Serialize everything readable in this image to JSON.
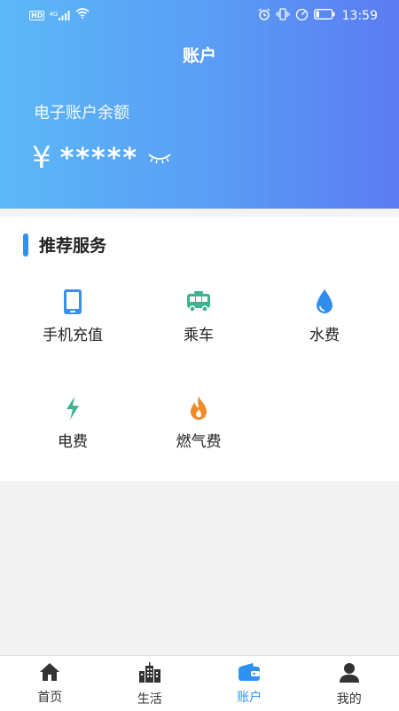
{
  "status_bar": {
    "hd_badge": "HD",
    "signal_type": "4G",
    "battery_level": 0.2,
    "time": "13:59"
  },
  "header": {
    "title": "账户",
    "balance_label": "电子账户余额",
    "currency_symbol": "¥",
    "balance_masked": "*****"
  },
  "services": {
    "section_title": "推荐服务",
    "items": [
      {
        "label": "手机充值",
        "icon": "phone-icon",
        "color": "#3a8ef0"
      },
      {
        "label": "乘车",
        "icon": "bus-icon",
        "color": "#3fb28f"
      },
      {
        "label": "水费",
        "icon": "water-drop-icon",
        "color": "#2f8ef0"
      },
      {
        "label": "电费",
        "icon": "lightning-icon",
        "color": "#3fb28f"
      },
      {
        "label": "燃气费",
        "icon": "flame-icon",
        "color": "#f08a2c"
      }
    ]
  },
  "tabbar": {
    "active_index": 2,
    "accent": "#2f92f3",
    "tabs": [
      {
        "label": "首页",
        "icon": "home-icon"
      },
      {
        "label": "生活",
        "icon": "city-icon"
      },
      {
        "label": "账户",
        "icon": "wallet-icon"
      },
      {
        "label": "我的",
        "icon": "user-icon"
      }
    ]
  }
}
